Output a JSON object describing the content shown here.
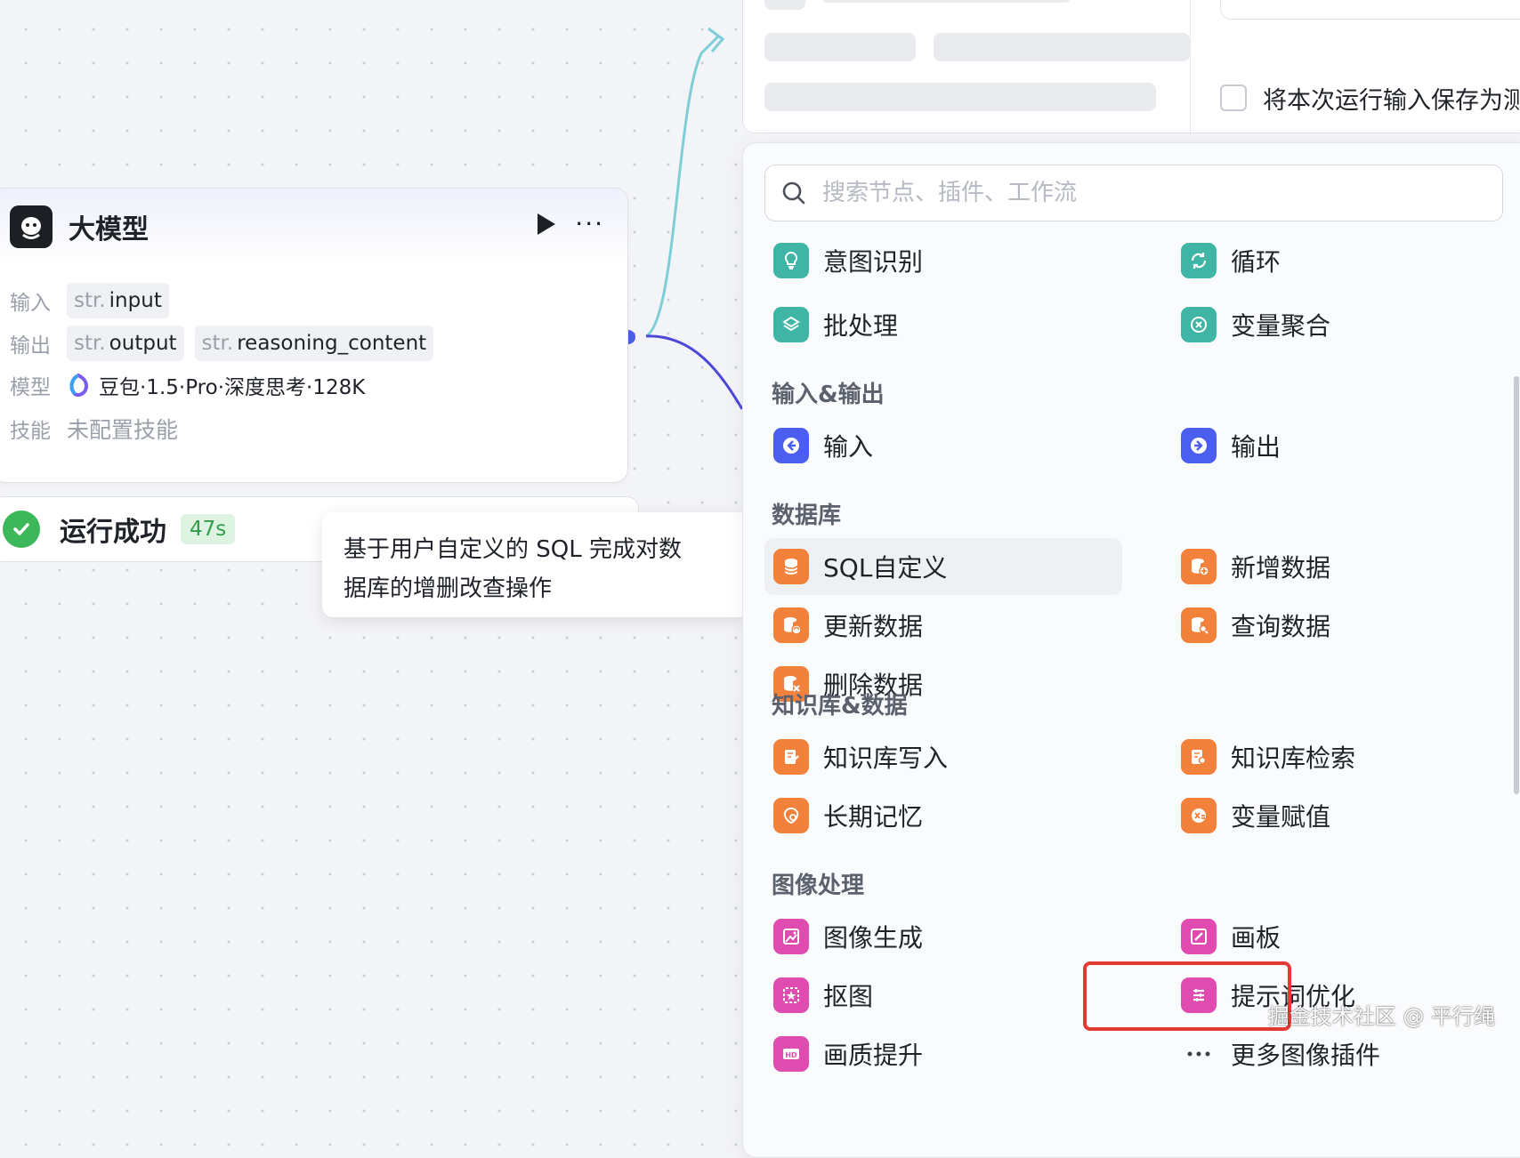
{
  "node": {
    "title": "大模型",
    "input_label": "输入",
    "output_label": "输出",
    "model_label": "模型",
    "skill_label": "技能",
    "inputs": [
      {
        "type": "str.",
        "name": "input"
      }
    ],
    "outputs": [
      {
        "type": "str.",
        "name": "output"
      },
      {
        "type": "str.",
        "name": "reasoning_content"
      }
    ],
    "model_value": "豆包·1.5·Pro·深度思考·128K",
    "skill_value": "未配置技能"
  },
  "status": {
    "text": "运行成功",
    "time": "47s"
  },
  "tooltip": {
    "line1": "基于用户自定义的 SQL 完成对数",
    "line2": "据库的增删改查操作"
  },
  "test_panel": {
    "save_checkbox_label": "将本次运行输入保存为测"
  },
  "picker": {
    "search_placeholder": "搜索节点、插件、工作流",
    "categories": {
      "io": "输入&输出",
      "database": "数据库",
      "knowledge": "知识库&数据",
      "image": "图像处理"
    },
    "items": {
      "intent": "意图识别",
      "loop": "循环",
      "batch": "批处理",
      "var_agg": "变量聚合",
      "input": "输入",
      "output": "输出",
      "sql": "SQL自定义",
      "insert": "新增数据",
      "update": "更新数据",
      "query": "查询数据",
      "delete": "删除数据",
      "kb_write": "知识库写入",
      "kb_search": "知识库检索",
      "memory": "长期记忆",
      "var_assign": "变量赋值",
      "img_gen": "图像生成",
      "canvas": "画板",
      "cutout": "抠图",
      "prompt_opt": "提示词优化",
      "hd": "画质提升",
      "more_img": "更多图像插件"
    }
  },
  "colors": {
    "teal": "#3fb5a6",
    "blue": "#4b5ef0",
    "orange": "#f2813b",
    "pink": "#e04bb0",
    "success": "#3cb85b",
    "highlight": "#e53935"
  },
  "watermark": "掘金技术社区 @ 平行绳"
}
